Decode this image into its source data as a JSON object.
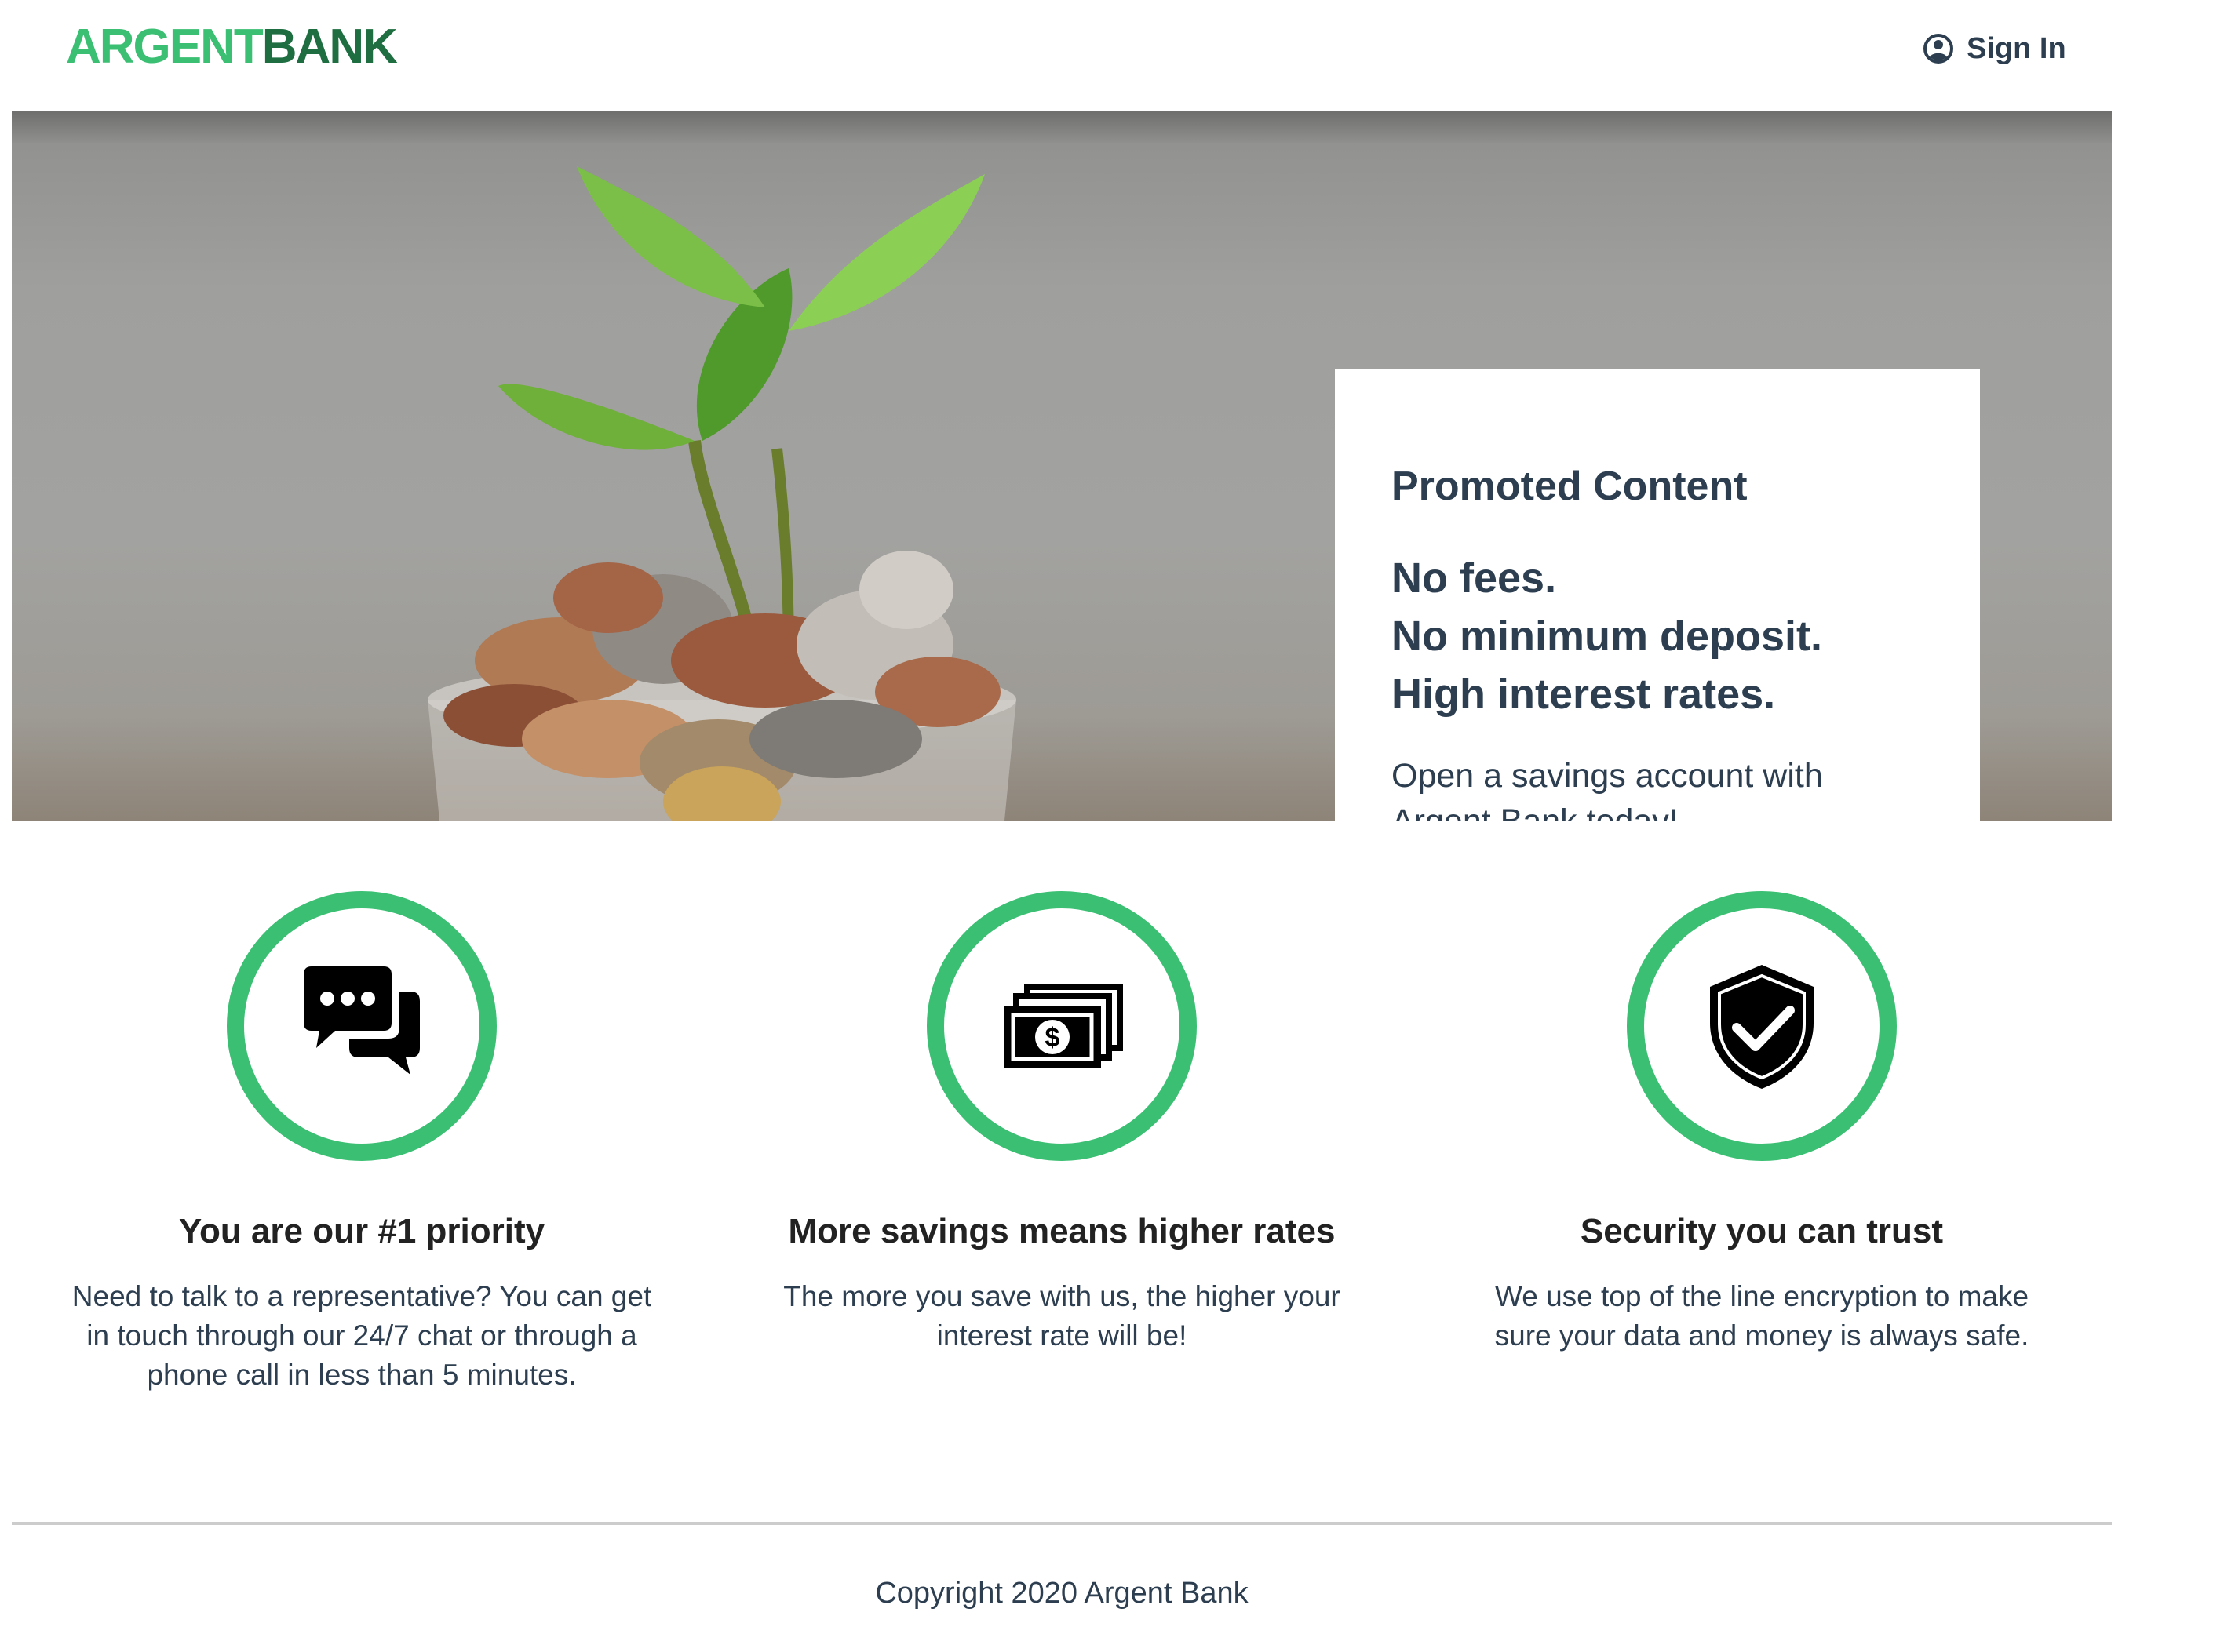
{
  "header": {
    "logo_part1": "ARGENT",
    "logo_part2": "BANK",
    "sign_in_label": "Sign In",
    "sign_in_icon": "user-circle-icon"
  },
  "hero": {
    "image": "seedling growing from a glass jar of coins",
    "promo": {
      "subtitle": "Promoted Content",
      "lines": [
        "No fees.",
        "No minimum deposit.",
        "High interest rates."
      ],
      "text": "Open a savings account with Argent Bank today!"
    }
  },
  "features": [
    {
      "icon": "chat-bubbles-icon",
      "title": "You are our #1 priority",
      "text": "Need to talk to a representative? You can get in touch through our 24/7 chat or through a phone call in less than 5 minutes."
    },
    {
      "icon": "money-bills-icon",
      "title": "More savings means higher rates",
      "text": "The more you save with us, the higher your interest rate will be!"
    },
    {
      "icon": "shield-check-icon",
      "title": "Security you can trust",
      "text": "We use top of the line encryption to make sure your data and money is always safe."
    }
  ],
  "footer": {
    "copyright": "Copyright 2020 Argent Bank"
  },
  "colors": {
    "accent": "#3bbf73",
    "logo_dark": "#1e6e42",
    "text": "#2c3e50"
  }
}
